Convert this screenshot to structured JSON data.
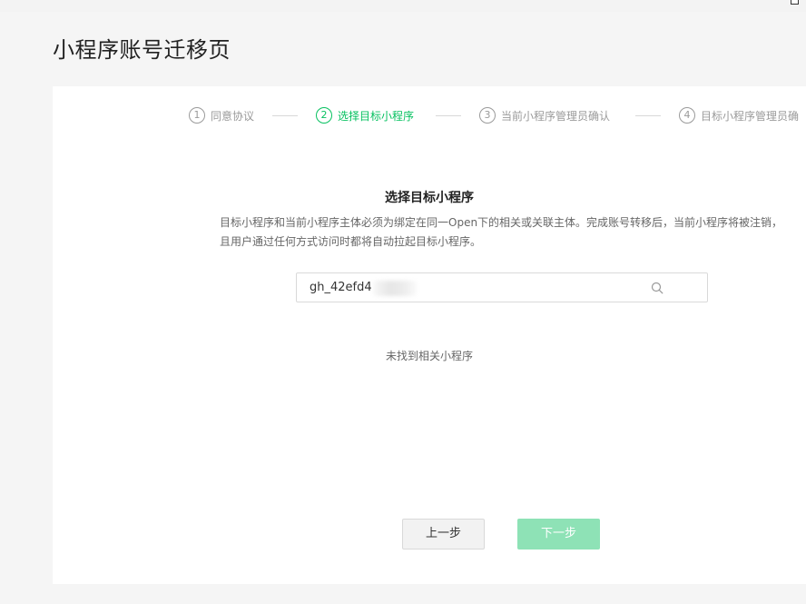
{
  "page": {
    "title": "小程序账号迁移页"
  },
  "steps": [
    {
      "num": "1",
      "label": "同意协议",
      "active": false
    },
    {
      "num": "2",
      "label": "选择目标小程序",
      "active": true
    },
    {
      "num": "3",
      "label": "当前小程序管理员确认",
      "active": false
    },
    {
      "num": "4",
      "label": "目标小程序管理员确",
      "active": false
    }
  ],
  "section": {
    "title": "选择目标小程序",
    "description": "目标小程序和当前小程序主体必须为绑定在同一Open下的相关或关联主体。完成账号转移后，当前小程序将被注销，且用户通过任何方式访问时都将自动拉起目标小程序。"
  },
  "search": {
    "value": "gh_42efd4",
    "icon": "search-icon"
  },
  "result": {
    "empty_text": "未找到相关小程序"
  },
  "buttons": {
    "prev_label": "上一步",
    "next_label": "下一步"
  },
  "colors": {
    "accent": "#07c160",
    "disabled_button": "#8ee2b6",
    "muted_text": "#9a9a9a"
  }
}
